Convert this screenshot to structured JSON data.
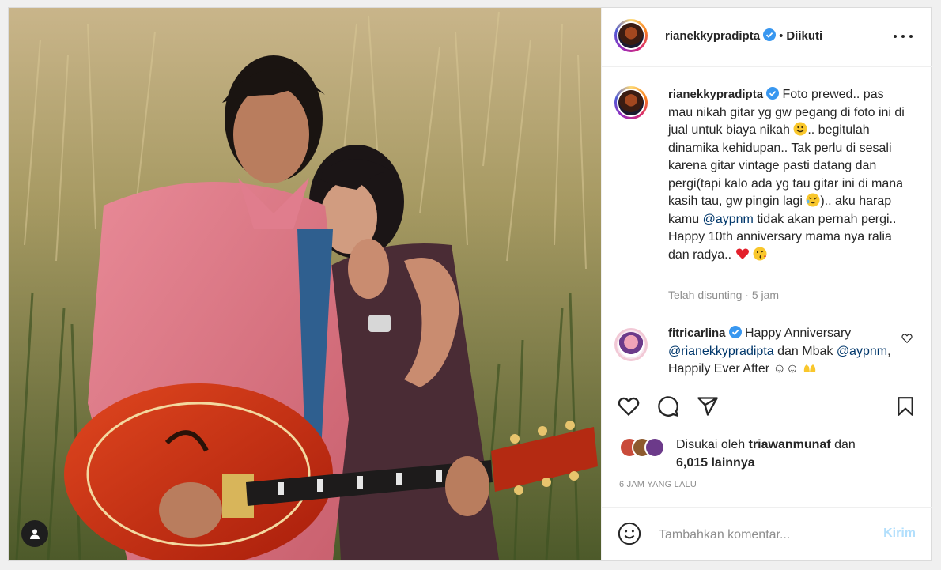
{
  "post": {
    "author": {
      "username": "rianekkypradipta",
      "verified": true
    },
    "follow_status": "Diikuti",
    "separator": "•",
    "caption": {
      "part1": "Foto prewed.. pas mau nikah gitar yg gw pegang di foto ini di jual untuk biaya nikah",
      "part2": ".. begitulah dinamika kehidupan.. Tak perlu di sesali karena gitar vintage pasti datang dan pergi(tapi kalo ada yg tau gitar ini di mana kasih tau, gw pingin lagi",
      "part3": ").. aku harap kamu",
      "mention": "@aypnm",
      "part4": "tidak akan pernah pergi.. Happy 10th anniversary mama nya ralia dan radya..",
      "emojis": [
        "smiley-emoji",
        "rofl-emoji",
        "red-heart-emoji",
        "kiss-emoji"
      ]
    },
    "caption_meta": "Telah disunting · 5 jam",
    "comments": [
      {
        "username": "fitricarlina",
        "verified": true,
        "text1": "Happy Anniversary",
        "mention1": "@rianekkypradipta",
        "text2": "dan Mbak",
        "mention2": "@aypnm",
        "text3": ", Happily Ever After ☺☺",
        "emoji": "hands-emoji"
      }
    ],
    "likes": {
      "prefix": "Disukai oleh",
      "user": "triawanmunaf",
      "and": "dan",
      "count": "6,015 lainnya"
    },
    "timestamp": "6 JAM YANG LALU",
    "add_comment": {
      "placeholder": "Tambahkan komentar...",
      "post_label": "Kirim"
    }
  },
  "icons": {
    "like": "heart-icon",
    "comment": "comment-icon",
    "share": "paper-plane-icon",
    "save": "bookmark-icon",
    "more": "more-options-icon",
    "tagged": "tagged-user-icon",
    "emoji": "emoji-icon"
  },
  "colors": {
    "text": "#262626",
    "secondary": "#8e8e8e",
    "mention": "#00376b",
    "verified": "#3897f0",
    "post_disabled": "#b2dffc"
  }
}
